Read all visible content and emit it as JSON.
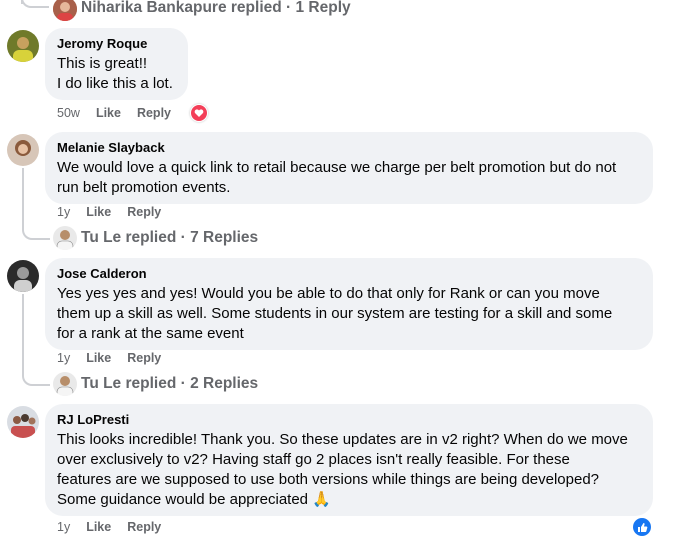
{
  "comments": [
    {
      "top_replies": {
        "label": "Niharika Bankapure replied · 1 Reply"
      }
    },
    {
      "author": "Jeromy Roque",
      "text": "This is great!!\nI do like this a lot.",
      "time": "50w",
      "like": "Like",
      "reply": "Reply",
      "reaction": "heart-reaction-icon"
    },
    {
      "author": "Melanie Slayback",
      "text": "We would love a quick link to retail because we charge per belt promotion but do not\nrun belt promotion events.",
      "time": "1y",
      "like": "Like",
      "reply": "Reply",
      "replies_label": "Tu Le replied · 7 Replies"
    },
    {
      "author": "Jose Calderon",
      "text": "Yes yes yes and yes! Would you be able to do that only for Rank or can you move\nthem up a skill as well. Some students in our system are testing for a skill and some\nfor a rank at the same event",
      "time": "1y",
      "like": "Like",
      "reply": "Reply",
      "replies_label": "Tu Le replied · 2 Replies"
    },
    {
      "author": "RJ LoPresti",
      "text": "This looks incredible! Thank you. So these updates are in v2 right? When do we move\nover exclusively to v2? Having staff go 2 places isn't really feasible. For these\nfeatures are we supposed to use both versions while things are being developed?\nSome guidance would be appreciated 🙏",
      "time": "1y",
      "like": "Like",
      "reply": "Reply",
      "reaction": "like-reaction-icon"
    }
  ],
  "colors": {
    "bubble": "#f0f2f5",
    "meta": "#65676b",
    "heart": "#f33e58",
    "like": "#1877f2"
  }
}
